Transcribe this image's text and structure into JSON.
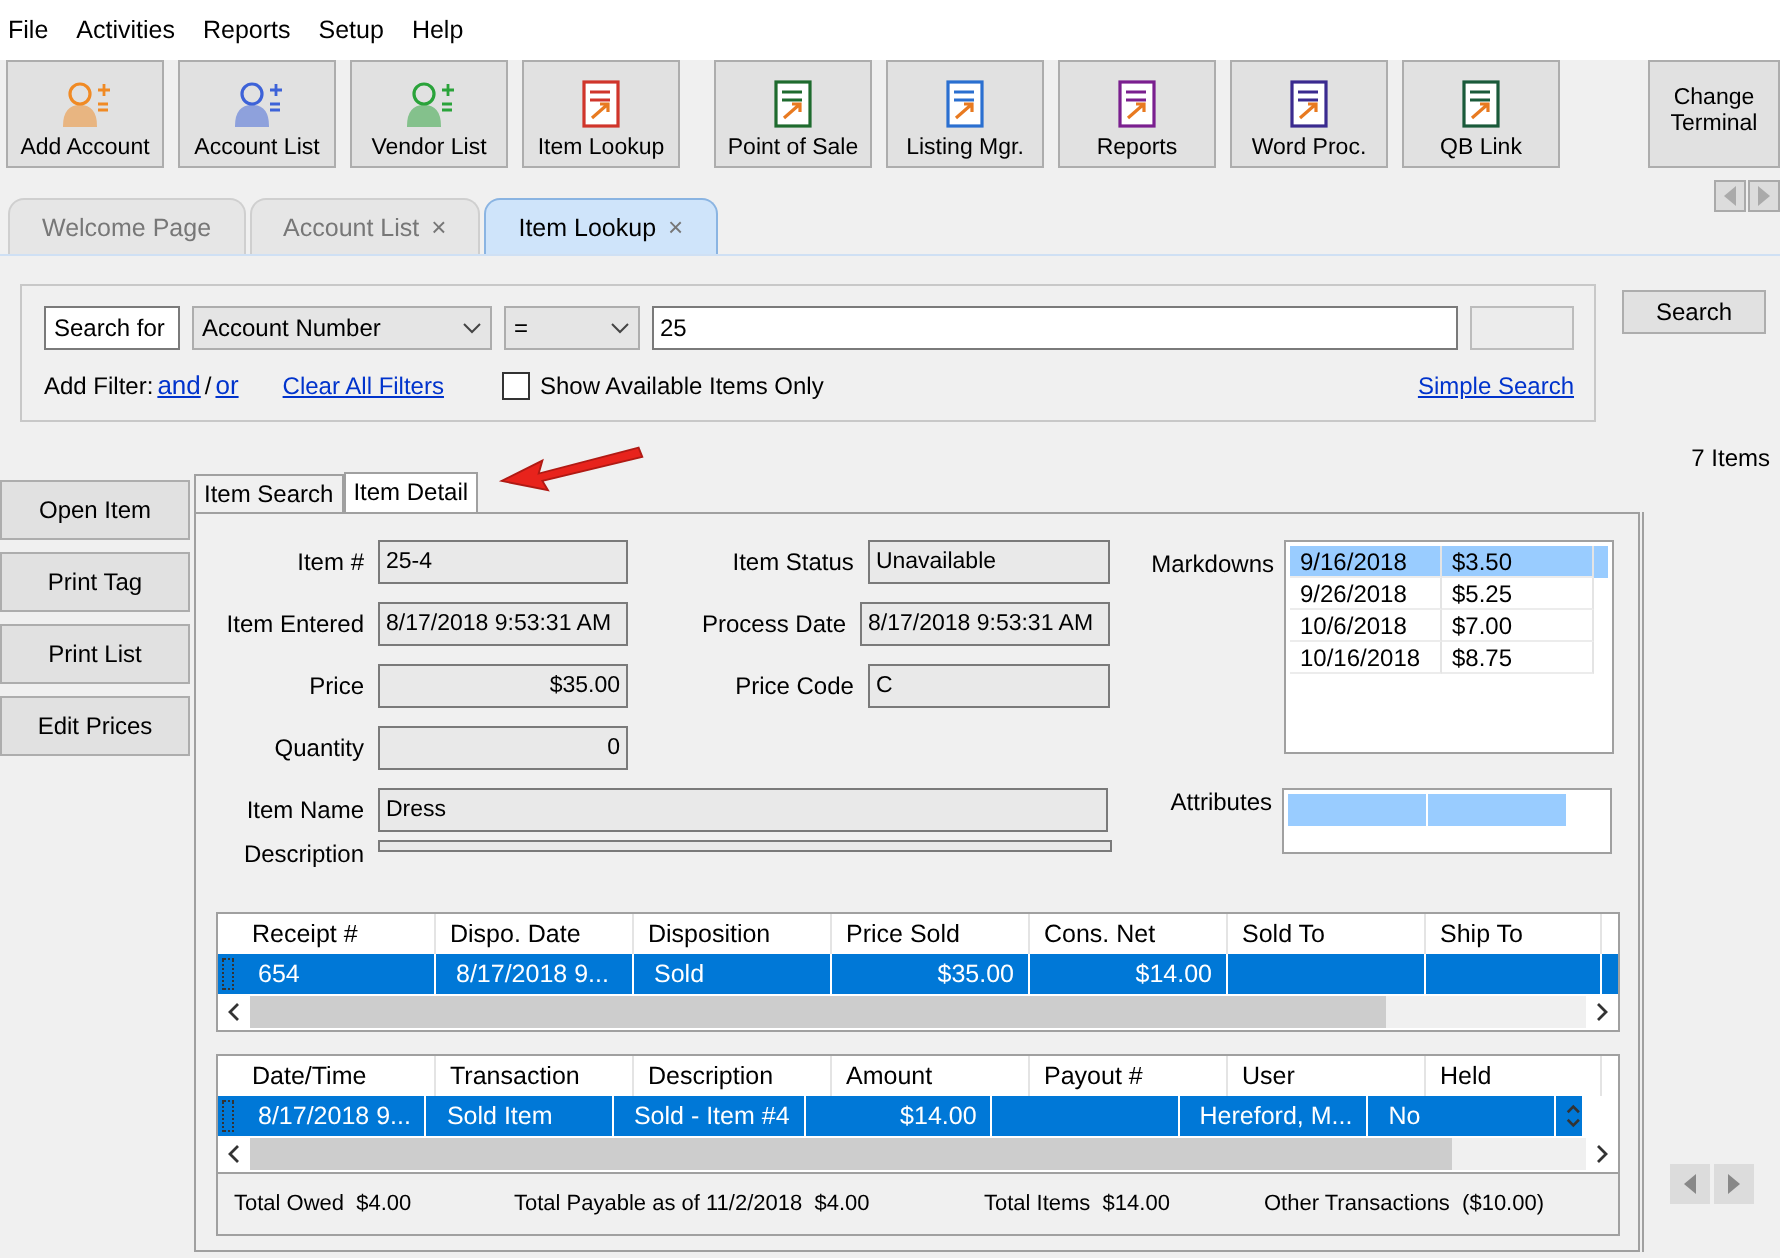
{
  "menu": [
    "File",
    "Activities",
    "Reports",
    "Setup",
    "Help"
  ],
  "toolbar_groups": [
    [
      "Add Account",
      "Account List",
      "Vendor List",
      "Item Lookup"
    ],
    [
      "Point of Sale",
      "Listing Mgr.",
      "Reports",
      "Word Proc.",
      "QB Link"
    ]
  ],
  "change_terminal": "Change Terminal",
  "tabs": [
    {
      "label": "Welcome Page",
      "closable": false,
      "selected": false
    },
    {
      "label": "Account List",
      "closable": true,
      "selected": false
    },
    {
      "label": "Item Lookup",
      "closable": true,
      "selected": true
    }
  ],
  "close_mark": "×",
  "search": {
    "label": "Search for",
    "field": "Account Number",
    "operator": "=",
    "value": "25",
    "button": "Search"
  },
  "filter": {
    "label": "Add Filter:",
    "and": "and",
    "slash": "/",
    "or": "or",
    "clear": "Clear All Filters",
    "checkbox": {
      "label": "Show Available Items Only",
      "checked": false
    },
    "simple": "Simple Search"
  },
  "item_count": "7 Items",
  "actions": [
    "Open Item",
    "Print Tag",
    "Print List",
    "Edit Prices"
  ],
  "detail_tabs": [
    {
      "label": "Item Search",
      "selected": false
    },
    {
      "label": "Item Detail",
      "selected": true
    }
  ],
  "item_fields": [
    {
      "label": "Item #",
      "value": "25-4",
      "numeric": false
    },
    {
      "label": "Item Entered",
      "value": "8/17/2018 9:53:31 AM",
      "numeric": false
    },
    {
      "label": "Price",
      "value": "$35.00",
      "numeric": true
    },
    {
      "label": "Quantity",
      "value": "0",
      "numeric": true
    }
  ],
  "status_fields": [
    {
      "label": "Item Status",
      "value": "Unavailable"
    },
    {
      "label": "Process Date",
      "value": "8/17/2018 9:53:31 AM"
    },
    {
      "label": "Price Code",
      "value": "C"
    }
  ],
  "item_name": {
    "label": "Item Name",
    "value": "Dress"
  },
  "description": {
    "label": "Description"
  },
  "markdowns": {
    "label": "Markdowns",
    "rows": [
      {
        "date": "9/16/2018",
        "amount": "$3.50",
        "selected": true
      },
      {
        "date": "9/26/2018",
        "amount": "$5.25",
        "selected": false
      },
      {
        "date": "10/6/2018",
        "amount": "$7.00",
        "selected": false
      },
      {
        "date": "10/16/2018",
        "amount": "$8.75",
        "selected": false
      }
    ]
  },
  "attributes": {
    "label": "Attributes"
  },
  "dispositions": {
    "columns": [
      "Receipt #",
      "Dispo. Date",
      "Disposition",
      "Price Sold",
      "Cons. Net",
      "Sold To",
      "Ship To"
    ],
    "rows": [
      {
        "cells": [
          "654",
          "8/17/2018 9...",
          "Sold",
          "$35.00",
          "$14.00",
          "",
          ""
        ],
        "selected": true
      }
    ]
  },
  "transactions": {
    "columns": [
      "Date/Time",
      "Transaction",
      "Description",
      "Amount",
      "Payout #",
      "User",
      "Held"
    ],
    "rows": [
      {
        "cells": [
          "8/17/2018 9...",
          "Sold Item",
          "Sold - Item #4",
          "$14.00",
          "",
          "Hereford, M...",
          "No"
        ],
        "selected": true
      }
    ]
  },
  "totals": [
    {
      "label": "Total Owed",
      "value": "$4.00"
    },
    {
      "label": "Total Payable as of 11/2/2018",
      "value": "$4.00"
    },
    {
      "label": "Total Items",
      "value": "$14.00"
    },
    {
      "label": "Other Transactions",
      "value": "($10.00)"
    }
  ]
}
